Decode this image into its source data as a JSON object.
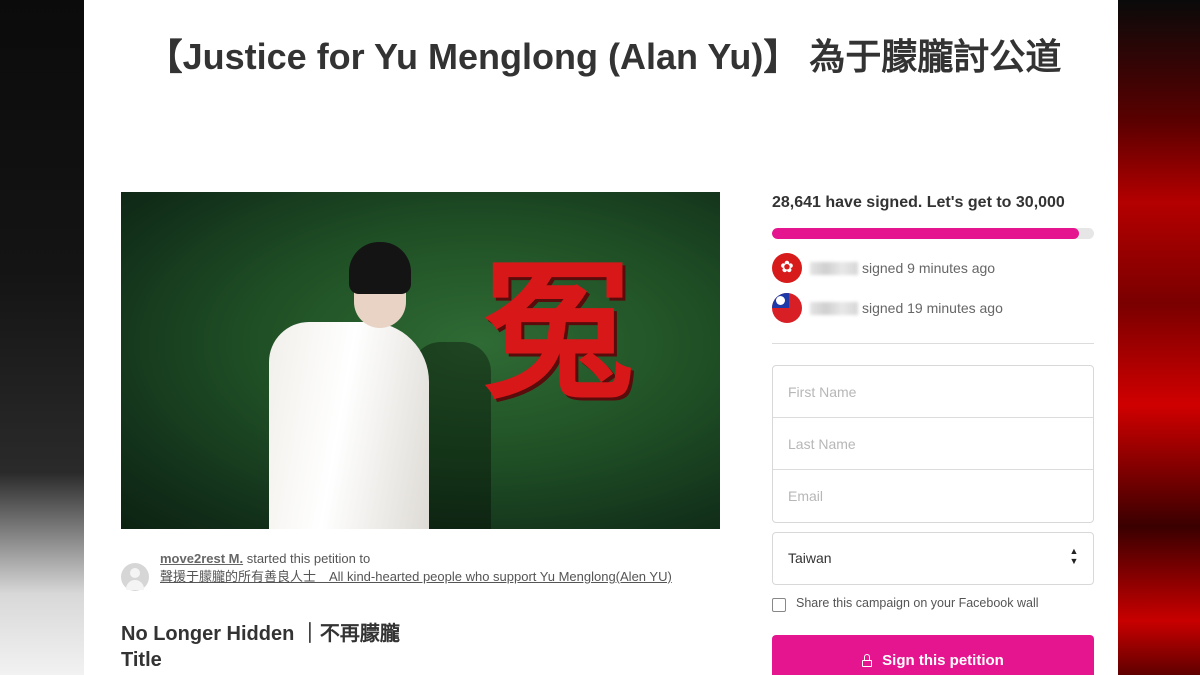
{
  "petition": {
    "title": "【Justice for Yu Menglong (Alan Yu)】 為于朦朧討公道",
    "hero_glyph": "冤",
    "starter": {
      "user": "move2rest M.",
      "started_text": " started this petition to",
      "recipient": "聲援于朦朧的所有善良人士　All kind-hearted people who support Yu Menglong(Alen YU)"
    },
    "subheading": "No Longer Hidden ｜不再朦朧",
    "section_title": "Title"
  },
  "signatures": {
    "count_text": "28,641 have signed. Let's get to 30,000",
    "signed": 28641,
    "goal": 30000,
    "recent": [
      {
        "flag": "hong-kong-flag-icon",
        "text": "signed 9 minutes ago"
      },
      {
        "flag": "taiwan-flag-icon",
        "text": "signed 19 minutes ago"
      }
    ]
  },
  "form": {
    "first_name_placeholder": "First Name",
    "last_name_placeholder": "Last Name",
    "email_placeholder": "Email",
    "country": "Taiwan",
    "share_label": "Share this campaign on your Facebook wall",
    "sign_button": "Sign this petition"
  },
  "colors": {
    "accent": "#e5158f",
    "progress_track": "#e6e6e6",
    "text": "#333333"
  }
}
